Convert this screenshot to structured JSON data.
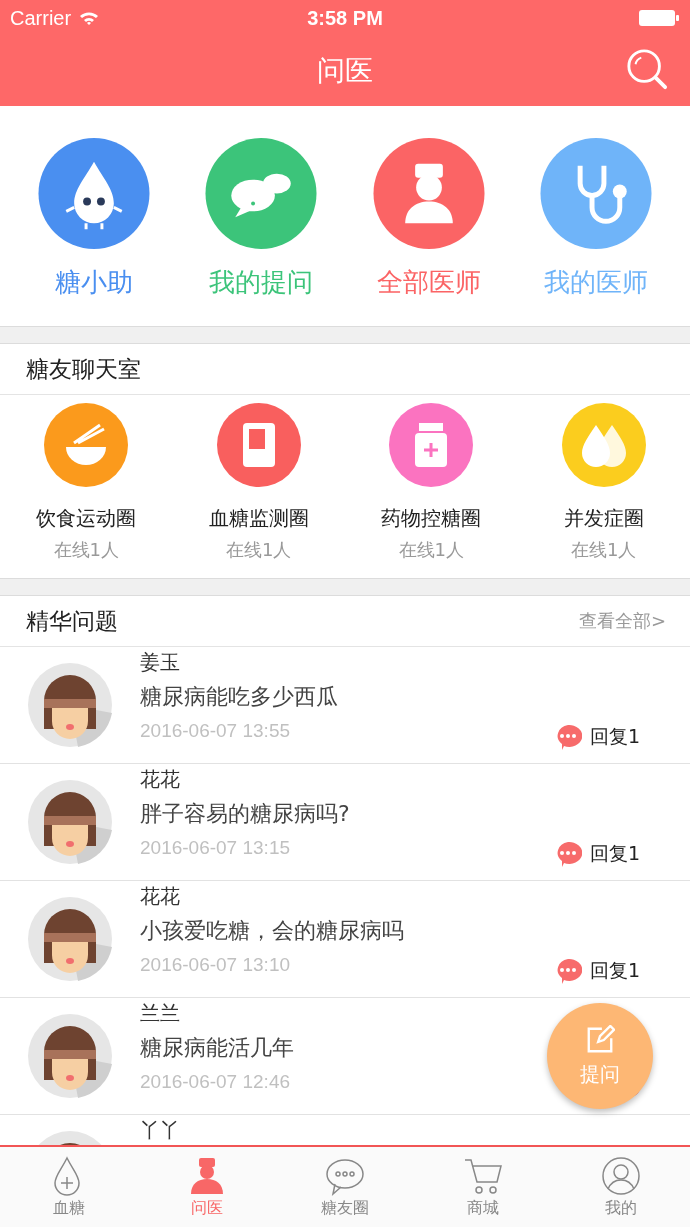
{
  "status_bar": {
    "carrier": "Carrier",
    "time": "3:58 PM"
  },
  "nav": {
    "title": "问医"
  },
  "quick": [
    {
      "label": "糖小助",
      "color": "#4a8ff0",
      "kind": "drop"
    },
    {
      "label": "我的提问",
      "color": "#3cc47a",
      "kind": "chat"
    },
    {
      "label": "全部医师",
      "color": "#fb6465",
      "kind": "doctor"
    },
    {
      "label": "我的医师",
      "color": "#6fb4f9",
      "kind": "stethoscope"
    }
  ],
  "chat_room": {
    "title": "糖友聊天室",
    "circles": [
      {
        "name": "饮食运动圈",
        "online": "在线1人",
        "color": "#fb9a1c",
        "kind": "noodles"
      },
      {
        "name": "血糖监测圈",
        "online": "在线1人",
        "color": "#f95f5e",
        "kind": "meter"
      },
      {
        "name": "药物控糖圈",
        "online": "在线1人",
        "color": "#fb73c0",
        "kind": "pill"
      },
      {
        "name": "并发症圈",
        "online": "在线1人",
        "color": "#fbcd1e",
        "kind": "drops"
      }
    ]
  },
  "questions": {
    "title": "精华问题",
    "more": "查看全部>",
    "rows": [
      {
        "name": "姜玉",
        "question": "糖尿病能吃多少西瓜",
        "time": "2016-06-07 13:55",
        "reply": "回复1"
      },
      {
        "name": "花花",
        "question": "胖子容易的糖尿病吗?",
        "time": "2016-06-07 13:15",
        "reply": "回复1"
      },
      {
        "name": "花花",
        "question": "小孩爱吃糖，会的糖尿病吗",
        "time": "2016-06-07 13:10",
        "reply": "回复1"
      },
      {
        "name": "兰兰",
        "question": "糖尿病能活几年",
        "time": "2016-06-07 12:46"
      },
      {
        "name": "丫丫"
      }
    ]
  },
  "fab": {
    "label": "提问"
  },
  "tabs": [
    {
      "label": "血糖",
      "kind": "drop",
      "selected": false
    },
    {
      "label": "问医",
      "kind": "doctor",
      "selected": true
    },
    {
      "label": "糖友圈",
      "kind": "chat",
      "selected": false
    },
    {
      "label": "商城",
      "kind": "cart",
      "selected": false
    },
    {
      "label": "我的",
      "kind": "user",
      "selected": false
    }
  ]
}
